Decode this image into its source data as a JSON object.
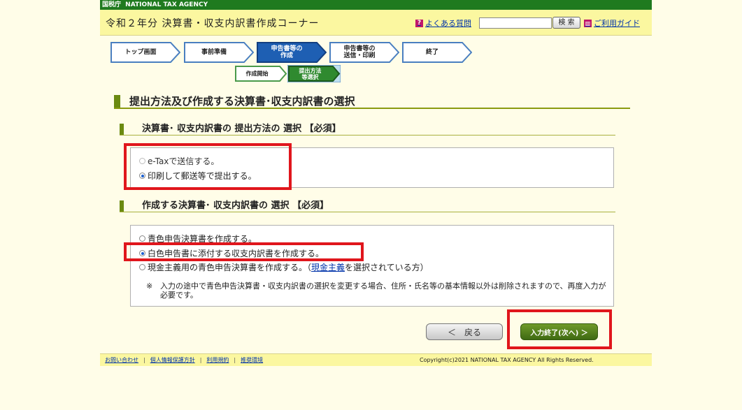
{
  "agency": {
    "label_ja": "国税庁",
    "label_en": "NATIONAL TAX AGENCY"
  },
  "header": {
    "title": "令和２年分 決算書・収支内訳書作成コーナー",
    "faq_link": "よくある質問",
    "search_placeholder": "",
    "search_button": "検 索",
    "guide_link": "ご利用ガイド"
  },
  "steps": [
    {
      "label": "トップ画面",
      "active": false
    },
    {
      "label": "事前準備",
      "active": false
    },
    {
      "label": "申告書等の\n作成",
      "active": true
    },
    {
      "label": "申告書等の\n送信・印刷",
      "active": false
    },
    {
      "label": "終了",
      "active": false
    }
  ],
  "substeps": [
    {
      "label": "作成開始",
      "active": false
    },
    {
      "label": "提出方法\n等選択",
      "active": true
    }
  ],
  "main": {
    "heading": "提出方法及び作成する決算書･収支内訳書の選択",
    "section1": {
      "heading": "決算書･ 収支内訳書の 提出方法の 選択 【必須】",
      "options": [
        {
          "label": "e-Taxで送信する。",
          "selected": false,
          "disabled": true
        },
        {
          "label": "印刷して郵送等で提出する。",
          "selected": true,
          "disabled": false
        }
      ]
    },
    "section2": {
      "heading": "作成する決算書･ 収支内訳書の 選択 【必須】",
      "options": [
        {
          "label": "青色申告決算書を作成する。",
          "selected": false
        },
        {
          "label": "白色申告書に添付する収支内訳書を作成する。",
          "selected": true
        },
        {
          "label": "現金主義用の青色申告決算書を作成する。（",
          "link": "現金主義",
          "suffix": "を選択されている方）",
          "selected": false
        }
      ],
      "note_mark": "※",
      "note": "入力の途中で青色申告決算書・収支内訳書の選択を変更する場合、住所・氏名等の基本情報以外は削除されますので、再度入力が必要です。"
    }
  },
  "buttons": {
    "back": "＜　戻る",
    "next": "入力終了(次へ) ＞"
  },
  "footer": {
    "links": [
      "お問い合わせ",
      "個人情報保護方針",
      "利用規約",
      "推奨環境"
    ],
    "separator": "|",
    "copyright": "Copyright(c)2021 NATIONAL TAX AGENCY All Rights Reserved."
  },
  "colors": {
    "accent_green": "#6b8a10",
    "active_step": "#1e5fb3",
    "highlight_red": "#e0161c"
  }
}
